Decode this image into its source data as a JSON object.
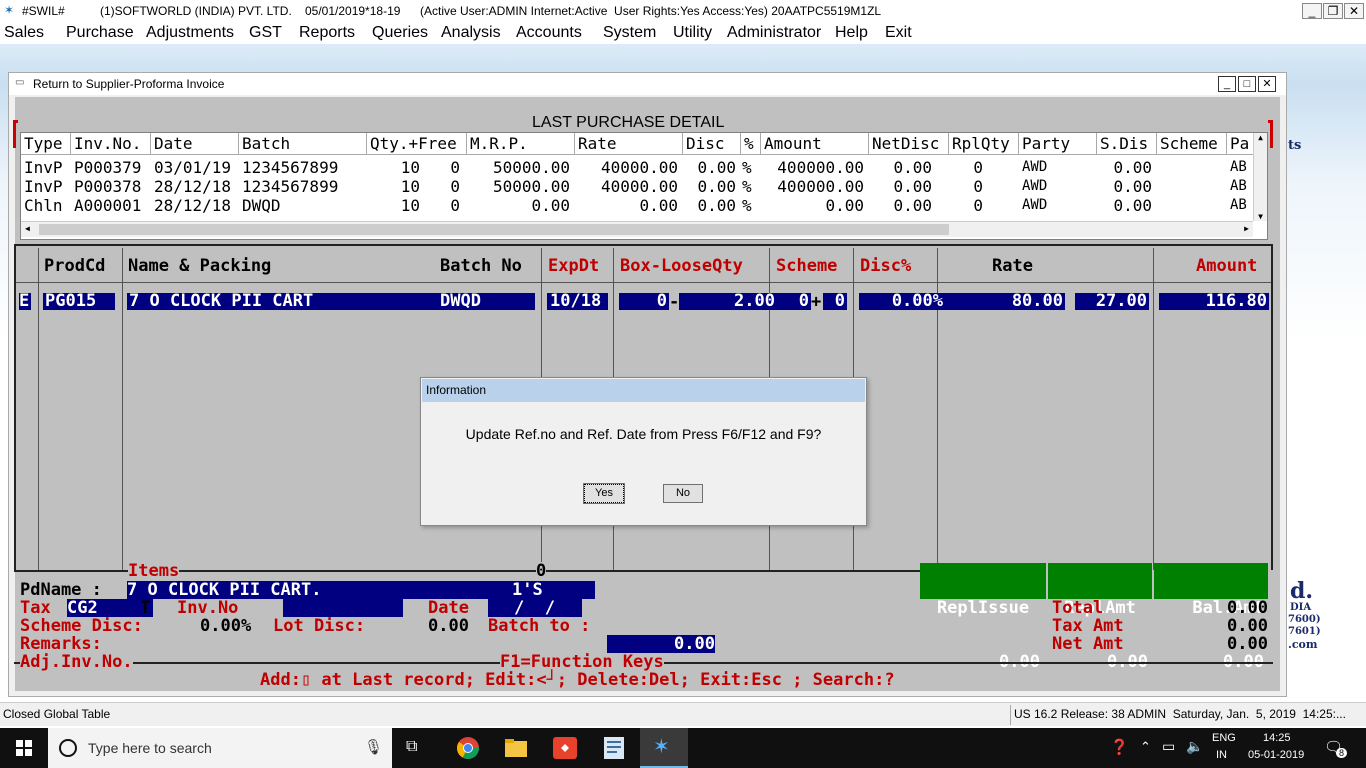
{
  "titlebar": {
    "app": "#SWIL#",
    "company": "(1)SOFTWORLD (INDIA) PVT. LTD.",
    "datetime": "05/01/2019*18-19",
    "status": "(Active User:ADMIN Internet:Active  User Rights:Yes Access:Yes) 20AATPC5519M1ZL"
  },
  "menu": [
    "Sales",
    "Purchase",
    "Adjustments",
    "GST",
    "Reports",
    "Queries",
    "Analysis",
    "Accounts",
    "System",
    "Utility",
    "Administrator",
    "Help",
    "Exit"
  ],
  "background_brand": {
    "ts": "ts",
    "d": "d.",
    "dia": "DIA",
    "p600": "7600)",
    "p601": "7601)",
    "com": ".com"
  },
  "window": {
    "title": "Return to Supplier-Proforma Invoice"
  },
  "last_purchase": {
    "title": "LAST PURCHASE DETAIL",
    "columns": [
      "Type",
      "Inv.No.",
      "Date",
      "Batch",
      "Qty.+Free",
      "M.R.P.",
      "Rate",
      "Disc",
      "%",
      "Amount",
      "NetDisc",
      "RplQty",
      "Party",
      "S.Dis",
      "Scheme",
      "Pa"
    ],
    "rows": [
      {
        "type": "InvP",
        "inv": "P000379",
        "date": "03/01/19",
        "batch": "1234567899",
        "qty": "10",
        "free": "0",
        "mrp": "50000.00",
        "rate": "40000.00",
        "disc": "0.00",
        "pct": "%",
        "amount": "400000.00",
        "netdisc": "0.00",
        "rplqty": "0",
        "party": "AWD",
        "sdis": "0.00",
        "scheme": "",
        "pa": "AB"
      },
      {
        "type": "InvP",
        "inv": "P000378",
        "date": "28/12/18",
        "batch": "1234567899",
        "qty": "10",
        "free": "0",
        "mrp": "50000.00",
        "rate": "40000.00",
        "disc": "0.00",
        "pct": "%",
        "amount": "400000.00",
        "netdisc": "0.00",
        "rplqty": "0",
        "party": "AWD",
        "sdis": "0.00",
        "scheme": "",
        "pa": "AB"
      },
      {
        "type": "Chln",
        "inv": "A000001",
        "date": "28/12/18",
        "batch": "DWQD",
        "qty": "10",
        "free": "0",
        "mrp": "0.00",
        "rate": "0.00",
        "disc": "0.00",
        "pct": "%",
        "amount": "0.00",
        "netdisc": "0.00",
        "rplqty": "0",
        "party": "AWD",
        "sdis": "0.00",
        "scheme": "",
        "pa": "AB"
      }
    ]
  },
  "grid": {
    "headers": {
      "prodcd": "ProdCd",
      "name": "Name & Packing",
      "batch": "Batch No",
      "expdt": "ExpDt",
      "boxloose": "Box-LooseQty",
      "scheme": "Scheme",
      "disc": "Disc%",
      "rate": "Rate",
      "amount": "Amount"
    },
    "row": {
      "flag": "E",
      "prodcd": "PG015",
      "name": "7 O CLOCK PII CART",
      "batch": "DWQD",
      "expdt": "10/18",
      "box": "0",
      "minus": "-",
      "loose": "2.00",
      "sch1": "0",
      "plus": "+",
      "sch2": "0",
      "disc": "0.00%",
      "rate": "80.00",
      "rate2": "27.00",
      "amount": "116.80"
    }
  },
  "footer": {
    "items_label": "Items",
    "items_count": "0",
    "repl_issue_label": "ReplIssue",
    "repl_issue": "0.00",
    "repl_amt_label": "ReplAmt",
    "repl_amt": "0.00",
    "bal_amt_label": "Bal.Amt",
    "bal_amt": "0.00",
    "pdname_label": "PdName :",
    "pdname": "7 O CLOCK PII CART.",
    "pack": "1'S",
    "tax_label": "Tax",
    "tax": "CG2",
    "tax_t": "T",
    "invno_label": "Inv.No",
    "date_label": "Date",
    "date_value": "/  /",
    "total_label": "Total",
    "total": "0.00",
    "scheme_disc_label": "Scheme Disc:",
    "scheme_disc": "0.00%",
    "lot_disc_label": "Lot Disc:",
    "lot_disc": "0.00",
    "batch_to_label": "Batch to :",
    "tax_amt_label": "Tax Amt",
    "tax_amt": "0.00",
    "remarks_label": "Remarks:",
    "remarks_value": "0.00",
    "net_amt_label": "Net Amt",
    "net_amt": "0.00",
    "adj_label": "Adj.Inv.No.",
    "fkeys": "F1=Function Keys",
    "help": "Add:⁠▯ at Last record; Edit:<┘; Delete:Del; Exit:Esc ; Search:?"
  },
  "dialog": {
    "title": "Information",
    "message": "Update Ref.no and Ref. Date from Press F6/F12 and F9?",
    "yes": "Yes",
    "no": "No"
  },
  "statusbar": {
    "left": "Closed Global Table",
    "right": "US 16.2 Release: 38 ADMIN  Saturday, Jan.  5, 2019  14:25:..."
  },
  "taskbar": {
    "search_placeholder": "Type here to search",
    "lang1": "ENG",
    "lang2": "IN",
    "time": "14:25",
    "date": "05-01-2019",
    "notif_count": "8"
  }
}
